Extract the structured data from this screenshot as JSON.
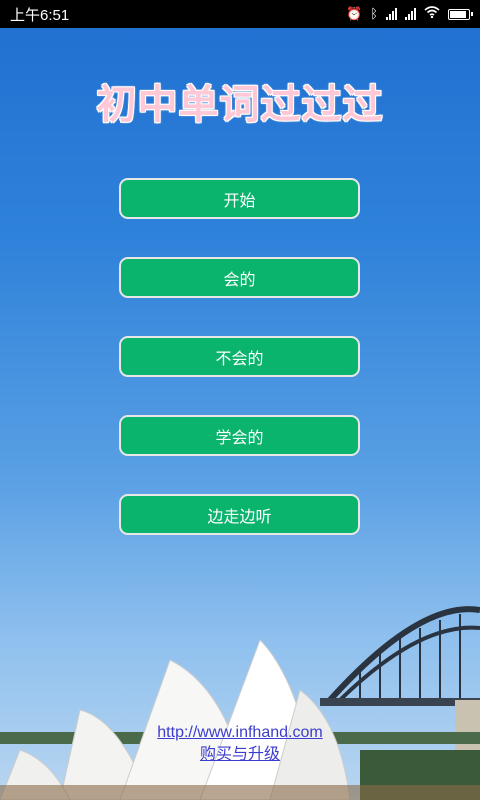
{
  "status_bar": {
    "time": "上午6:51",
    "battery_level_percent": 92
  },
  "app": {
    "title": "初中单词过过过"
  },
  "menu": {
    "start": "开始",
    "known": "会的",
    "unknown": "不会的",
    "learned": "学会的",
    "walk_and_listen": "边走边听"
  },
  "footer": {
    "website": "http://www.infhand.com",
    "purchase": "购买与升级"
  },
  "colors": {
    "button_bg": "#0bb46d",
    "title_text": "#ffc8d6",
    "link": "#3c3ccf"
  }
}
